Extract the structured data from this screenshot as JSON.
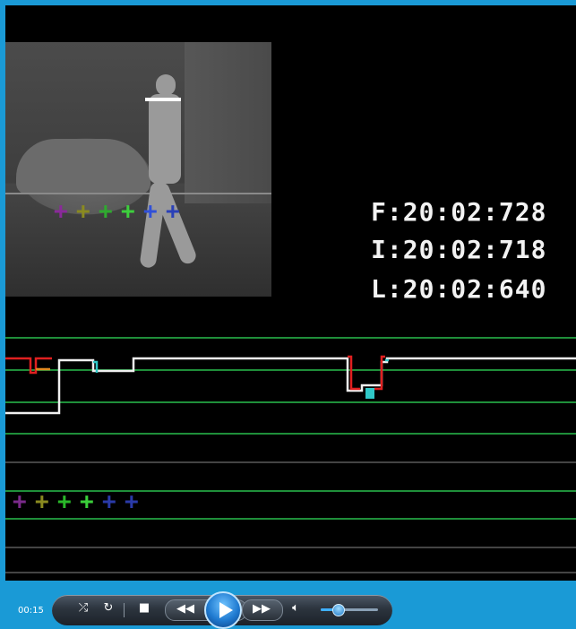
{
  "overlay": {
    "timestamps": [
      "F:20:02:728",
      "I:20:02:718",
      "L:20:02:640"
    ]
  },
  "markers": {
    "glyph": "+",
    "thumb_colors": [
      "#8a2a9a",
      "#8a8a20",
      "#2faa2f",
      "#3dcf3d",
      "#3050d8",
      "#2a40b8"
    ],
    "plot_colors": [
      "#7a2a8a",
      "#8a8a20",
      "#29b829",
      "#3acf3a",
      "#2a3aa8",
      "#2a3aa8"
    ]
  },
  "player": {
    "elapsed": "00:15",
    "controls": {
      "shuffle_icon": "shuffle-icon",
      "repeat_icon": "repeat-icon",
      "stop_icon": "stop-icon",
      "prev_icon": "rewind-icon",
      "play_icon": "play-icon",
      "next_icon": "fast-forward-icon",
      "mute_icon": "speaker-icon"
    },
    "volume": 0.3
  },
  "colors": {
    "window": "#1a9ad6",
    "track_green": "#1f8f3a",
    "track_gray": "#5a5a5a",
    "signal_white": "#f0f0f0",
    "signal_red": "#e02020",
    "signal_cyan": "#30c8c8",
    "signal_orange": "#e08a20"
  }
}
